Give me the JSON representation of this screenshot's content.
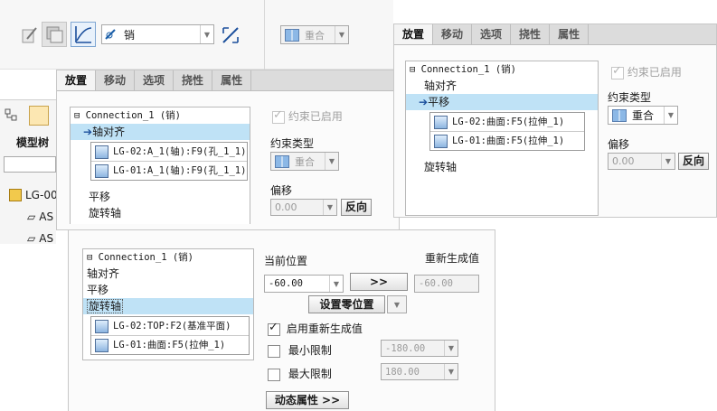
{
  "toolbar": {
    "joint_type": "销",
    "constraint_type": "重合"
  },
  "tabs": [
    "放置",
    "移动",
    "选项",
    "挠性",
    "属性"
  ],
  "left_strip": {
    "model_tree_label": "模型树",
    "tree_items": [
      "LG-00",
      "AS",
      "AS"
    ]
  },
  "panel_a": {
    "connection": "Connection_1 (销)",
    "items": [
      "轴对齐",
      "平移",
      "旋转轴"
    ],
    "refs": [
      "LG-02:A_1(轴):F9(孔_1_1)",
      "LG-01:A_1(轴):F9(孔_1_1)"
    ],
    "constraint_enabled": "约束已启用",
    "constraint_type_label": "约束类型",
    "constraint_type_value": "重合",
    "offset_label": "偏移",
    "offset_value": "0.00",
    "reverse_label": "反向"
  },
  "panel_b": {
    "connection": "Connection_1 (销)",
    "items": [
      "轴对齐",
      "平移",
      "旋转轴"
    ],
    "refs": [
      "LG-02:曲面:F5(拉伸_1)",
      "LG-01:曲面:F5(拉伸_1)"
    ],
    "constraint_enabled": "约束已启用",
    "constraint_type_label": "约束类型",
    "constraint_type_value": "重合",
    "offset_label": "偏移",
    "offset_value": "0.00",
    "reverse_label": "反向"
  },
  "panel_c": {
    "connection": "Connection_1 (销)",
    "items": [
      "轴对齐",
      "平移",
      "旋转轴"
    ],
    "refs": [
      "LG-02:TOP:F2(基准平面)",
      "LG-01:曲面:F5(拉伸_1)"
    ],
    "current_position_label": "当前位置",
    "regen_value_label": "重新生成值",
    "current_position_value": "-60.00",
    "arrow_button": ">>",
    "regen_value": "-60.00",
    "set_zero_label": "设置零位置",
    "enable_regen_label": "启用重新生成值",
    "min_limit_label": "最小限制",
    "min_limit_value": "-180.00",
    "max_limit_label": "最大限制",
    "max_limit_value": "180.00",
    "dynamic_props_label": "动态属性 >>"
  }
}
